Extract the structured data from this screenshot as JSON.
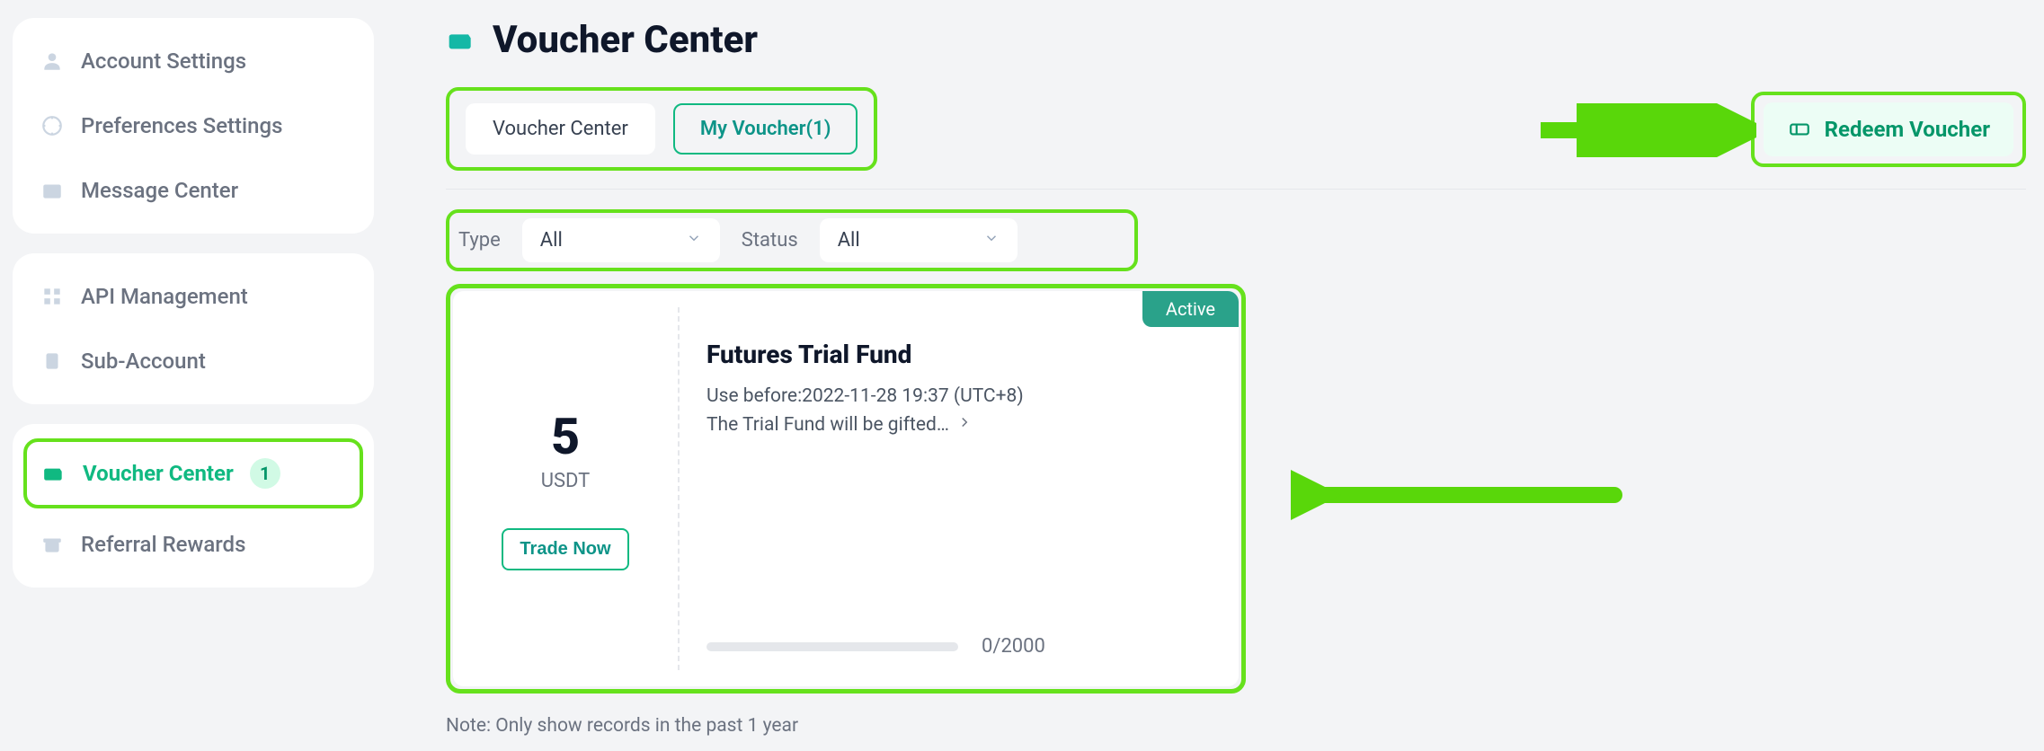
{
  "page": {
    "title": "Voucher Center"
  },
  "sidebar": {
    "groups": [
      {
        "items": [
          {
            "label": "Account Settings",
            "icon": "user-icon"
          },
          {
            "label": "Preferences Settings",
            "icon": "sliders-icon"
          },
          {
            "label": "Message Center",
            "icon": "inbox-icon"
          }
        ]
      },
      {
        "items": [
          {
            "label": "API Management",
            "icon": "grid-icon"
          },
          {
            "label": "Sub-Account",
            "icon": "clipboard-icon"
          }
        ]
      },
      {
        "items": [
          {
            "label": "Voucher Center",
            "icon": "wallet-icon",
            "active": true,
            "badge": "1"
          },
          {
            "label": "Referral Rewards",
            "icon": "gift-icon"
          }
        ]
      }
    ]
  },
  "tabs": {
    "voucher_center": "Voucher Center",
    "my_voucher": "My Voucher(1)"
  },
  "redeem": {
    "label": "Redeem Voucher"
  },
  "filters": {
    "type_label": "Type",
    "type_value": "All",
    "status_label": "Status",
    "status_value": "All"
  },
  "voucher": {
    "amount": "5",
    "unit": "USDT",
    "cta": "Trade Now",
    "status": "Active",
    "title": "Futures Trial Fund",
    "use_before": "Use before:2022-11-28 19:37 (UTC+8)",
    "description": "The Trial Fund will be gifted…",
    "progress_text": "0/2000"
  },
  "footer": {
    "note": "Note: Only show records in the past 1 year"
  }
}
